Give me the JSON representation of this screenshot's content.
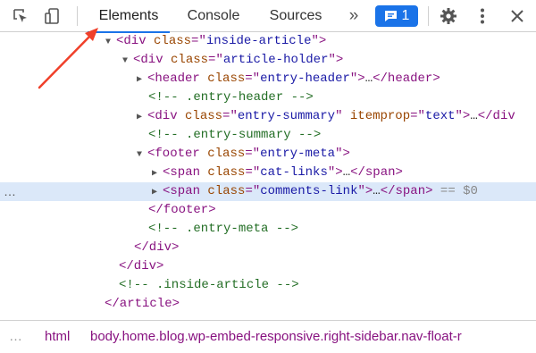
{
  "toolbar": {
    "tabs": [
      {
        "label": "Elements",
        "active": true
      },
      {
        "label": "Console",
        "active": false
      },
      {
        "label": "Sources",
        "active": false
      }
    ],
    "more_tabs": "»",
    "issues_count": "1",
    "icons": [
      "inspect-element-icon",
      "device-toolbar-icon",
      "message-icon",
      "gear-icon",
      "kebab-menu-icon",
      "close-icon"
    ],
    "accent_color": "#1a73e8"
  },
  "tree": {
    "rows": [
      {
        "open": "<",
        "tag_open": "div",
        "attr": "class",
        "value": "inside-article",
        "close": ">",
        "triangle": "▼"
      },
      {
        "tag_open": "div",
        "attr": "class",
        "value": "article-holder",
        "triangle": "▼"
      },
      {
        "tag_open": "header",
        "attr": "class",
        "value": "entry-header",
        "ellipsis": "…",
        "tag_close": "header",
        "triangle": "▶"
      },
      {
        "comment": "<!-- .entry-header -->"
      },
      {
        "tag_open": "div",
        "attr": "class",
        "value": "entry-summary",
        "attr2": "itemprop",
        "value2": "text",
        "ellipsis": "…",
        "tag_close_partial": "</div",
        "triangle": "▶"
      },
      {
        "comment": "<!-- .entry-summary -->"
      },
      {
        "tag_open": "footer",
        "attr": "class",
        "value": "entry-meta",
        "triangle": "▼"
      },
      {
        "tag_open": "span",
        "attr": "class",
        "value": "cat-links",
        "ellipsis": "…",
        "tag_close": "span",
        "triangle": "▶"
      },
      {
        "tag_open": "span",
        "attr": "class",
        "value": "comments-link",
        "ellipsis": "…",
        "tag_close": "span",
        "selected_suffix": "== $0",
        "row_dots": "…",
        "triangle": "▶"
      },
      {
        "tag_close_only": "</footer>"
      },
      {
        "comment": "<!-- .entry-meta -->"
      },
      {
        "tag_close_only": "</div>"
      },
      {
        "tag_close_only": "</div>"
      },
      {
        "comment": "<!-- .inside-article -->"
      },
      {
        "tag_close_only": "</article>"
      }
    ]
  },
  "breadcrumbs": {
    "dots": "…",
    "items": [
      "html",
      "body.home.blog.wp-embed-responsive.right-sidebar.nav-float-r"
    ]
  }
}
